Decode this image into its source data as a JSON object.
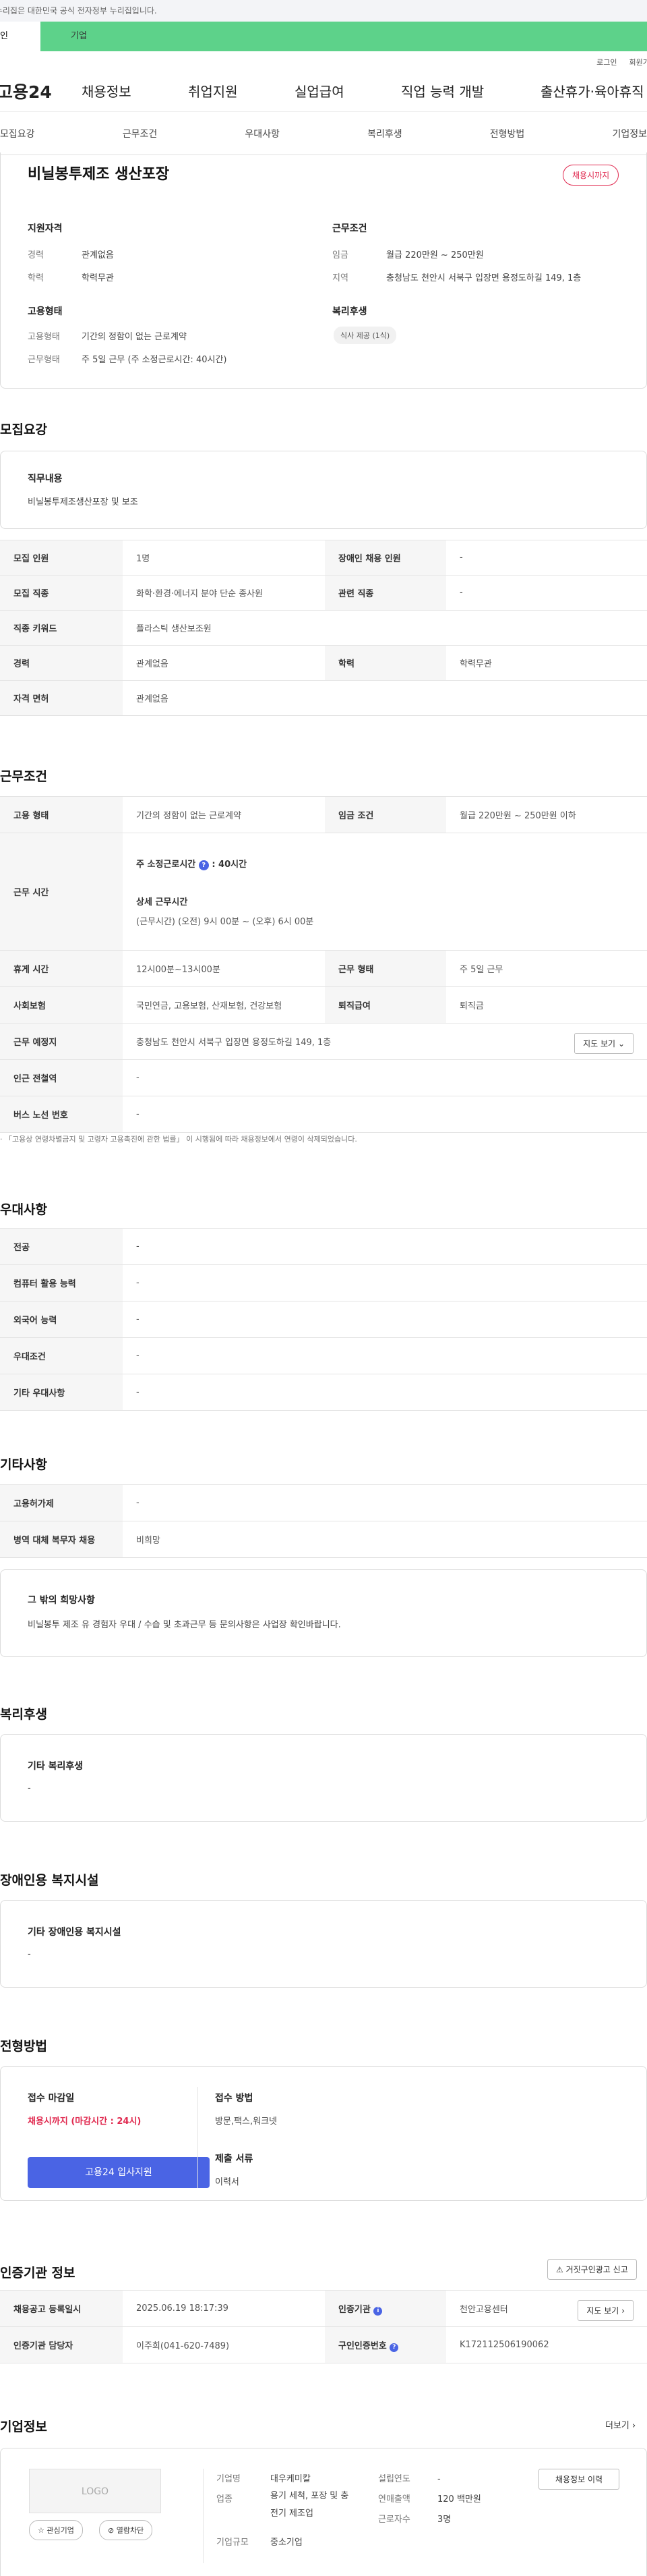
{
  "gov_banner": "이 누리집은 대한민국 공식 전자정부 누리집입니다.",
  "tabs": [
    "개인",
    "기업"
  ],
  "util": [
    "로그인",
    "회원가입"
  ],
  "logo": "고용24",
  "gnb": [
    "채용정보",
    "취업지원",
    "실업급여",
    "직업 능력 개발",
    "출산휴가·육아휴직"
  ],
  "lnb": [
    "모집요강",
    "근무조건",
    "우대사항",
    "복리후생",
    "전형방법",
    "기업정보"
  ],
  "summary": {
    "title": "비닐봉투제조 생산포장",
    "badge": "채용시까지",
    "qual_h": "지원자격",
    "career_l": "경력",
    "career": "관계없음",
    "edu_l": "학력",
    "edu": "학력무관",
    "emp_h": "고용형태",
    "emptype_l": "고용형태",
    "emptype": "기간의 정함이 없는 근로계약",
    "worktype_l": "근무형태",
    "worktype": "주 5일 근무 (주 소정근로시간: 40시간)",
    "cond_h": "근무조건",
    "wage_l": "임금",
    "wage": "월급 220만원 ~ 250만원",
    "area_l": "지역",
    "area": "충청남도 천안시 서북구 입장면 용정도하길 149, 1층",
    "welfare_h": "복리후생",
    "welfare_tag": "식사 제공 (1식)"
  },
  "recruit": {
    "title": "모집요강",
    "duty_h": "직무내용",
    "duty": "비닐봉투제조생산포장 및 보조",
    "rows": [
      [
        "모집 인원",
        "1명",
        "장애인 채용 인원",
        "-"
      ],
      [
        "모집 직종",
        "화학·환경·에너지 분야 단순 종사원",
        "관련 직종",
        "-"
      ]
    ],
    "keyword_l": "직종 키워드",
    "keyword": "플라스틱 생산보조원",
    "career_l": "경력",
    "career": "관계없음",
    "edu_l": "학력",
    "edu": "학력무관",
    "license_l": "자격 면허",
    "license": "관계없음"
  },
  "work": {
    "title": "근무조건",
    "type_l": "고용 형태",
    "type": "기간의 정함이 없는 근로계약",
    "wage_l": "임금 조건",
    "wage": "월급 220만원 ~ 250만원 이하",
    "time_l": "근무 시간",
    "time_main": "주 소정근로시간",
    "time_main_v": ": 40시간",
    "time_detail_h": "상세 근무시간",
    "time_detail": "(근무시간) (오전) 9시 00분 ~ (오후) 6시 00분",
    "break_l": "휴게 시간",
    "break": "12시00분~13시00분",
    "form_l": "근무 형태",
    "form": "주 5일 근무",
    "ins_l": "사회보험",
    "ins": "국민연금, 고용보험, 산재보험, 건강보험",
    "ret_l": "퇴직급여",
    "ret": "퇴직금",
    "place_l": "근무 예정지",
    "place": "충청남도 천안시 서북구 입장면 용정도하길 149, 1층",
    "map": "지도 보기",
    "subway_l": "인근 전철역",
    "subway": "-",
    "bus_l": "버스 노선 번호",
    "bus": "-",
    "note": "「고용상 연령차별금지 및 고령자 고용촉진에 관한 법률」 이 시행됨에 따라 채용정보에서 연령이 삭제되었습니다."
  },
  "pref": {
    "title": "우대사항",
    "rows": [
      [
        "전공",
        "-"
      ],
      [
        "컴퓨터 활용 능력",
        "-"
      ],
      [
        "외국어 능력",
        "-"
      ],
      [
        "우대조건",
        "-"
      ],
      [
        "기타 우대사항",
        "-"
      ]
    ]
  },
  "etc": {
    "title": "기타사항",
    "rows": [
      [
        "고용허가제",
        "-"
      ],
      [
        "병역 대체 복무자 채용",
        "비희망"
      ]
    ],
    "wish_h": "그 밖의 희망사항",
    "wish": "비닐봉투 제조 유 경험자 우대 / 수습 및 초과근무 등 문의사항은 사업장 확인바랍니다."
  },
  "welfare": {
    "title": "복리후생",
    "box_h": "기타 복리후생",
    "box": "-"
  },
  "disab": {
    "title": "장애인용 복지시설",
    "box_h": "기타 장애인용 복지시설",
    "box": "-"
  },
  "process": {
    "title": "전형방법",
    "deadline_h": "접수 마감일",
    "deadline": "채용시까지 (마감시간 : 24시)",
    "apply_btn": "고용24 입사지원",
    "method_h": "접수 방법",
    "method": "방문,팩스,워크넷",
    "docs_h": "제출 서류",
    "docs": "이력서"
  },
  "agency": {
    "title": "인증기관 정보",
    "report": "거짓구인광고 신고",
    "reg_l": "채용공고 등록일시",
    "reg": "2025.06.19 18:17:39",
    "org_l": "인증기관",
    "org": "천안고용센터",
    "map": "지도 보기",
    "mgr_l": "인증기관 담당자",
    "mgr": "이주희(041-620-7489)",
    "no_l": "구인인증번호",
    "no": "K172112506190062"
  },
  "company": {
    "title": "기업정보",
    "more": "더보기",
    "logo": "LOGO",
    "fav": "관심기업",
    "block": "열람차단",
    "name_l": "기업명",
    "name": "대우케미칼",
    "ind_l": "업종",
    "ind": "용기 세척, 포장 및 충전기 제조업",
    "size_l": "기업규모",
    "size": "중소기업",
    "year_l": "설립연도",
    "year": "-",
    "sales_l": "연매출액",
    "sales": "120 백만원",
    "emp_l": "근로자수",
    "emp": "3명",
    "history": "채용정보 이력"
  },
  "colors": {
    "green": "#5dd28a",
    "red": "#e0294f",
    "blue": "#4a64e4"
  }
}
